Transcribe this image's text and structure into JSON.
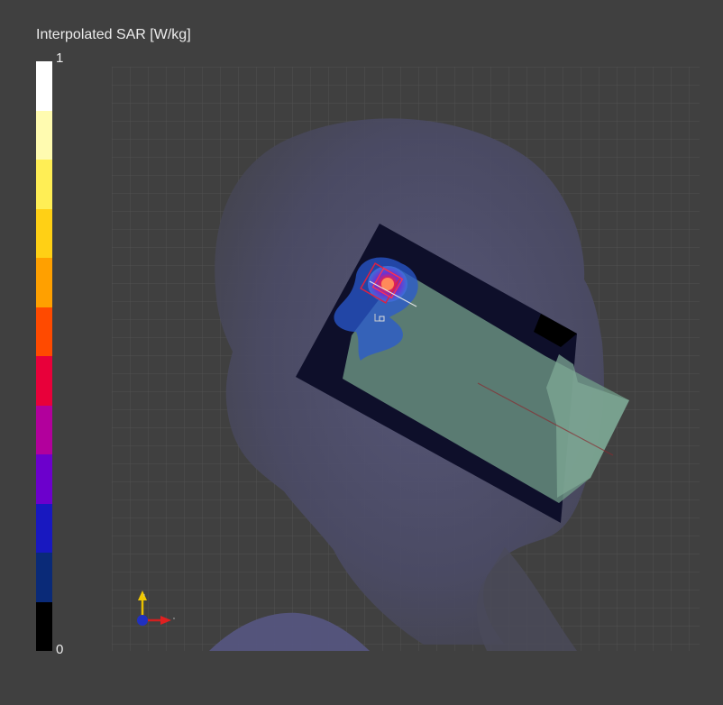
{
  "legend": {
    "title": "Interpolated SAR [W/kg]",
    "max_label": "1",
    "min_label": "0",
    "colors": [
      "#ffffff",
      "#fffbb0",
      "#ffee55",
      "#ffd015",
      "#ffa000",
      "#ff4a00",
      "#e8003a",
      "#b2009c",
      "#6c00cc",
      "#1818c0",
      "#0a2a78",
      "#000000"
    ]
  },
  "scene": {
    "background": "#404040",
    "grid_color": "#555555",
    "head_color": "#5a5a78",
    "phone_color": "#6e9684",
    "sar_peak": "#ff4040",
    "sar_low": "#2a5ad0"
  },
  "axes_triad": {
    "icons": [
      "y-axis-arrow-icon",
      "x-axis-arrow-icon",
      "z-axis-dot-icon"
    ]
  }
}
